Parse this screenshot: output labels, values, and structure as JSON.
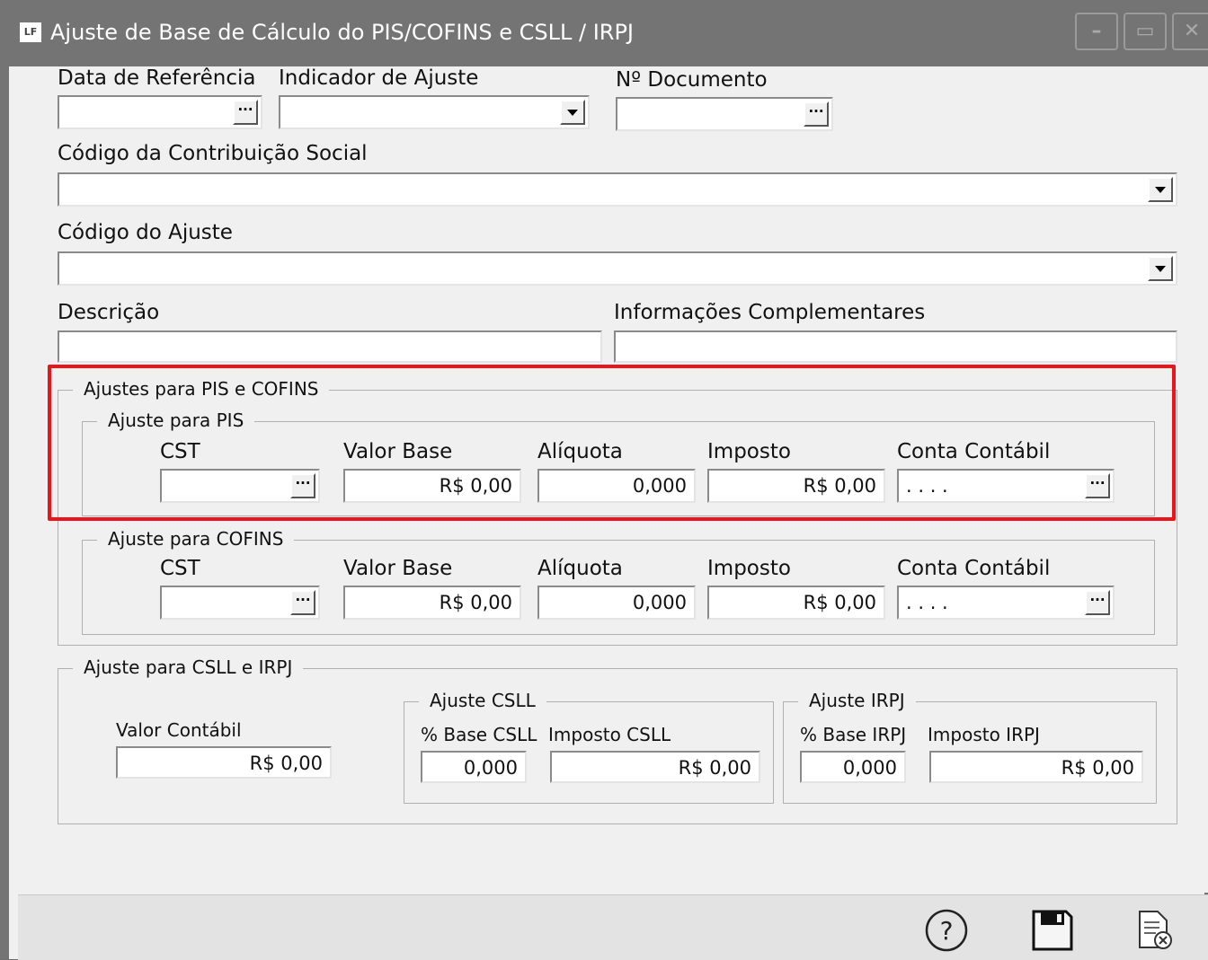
{
  "window": {
    "app_icon": "LF",
    "title": "Ajuste de Base de Cálculo do PIS/COFINS e CSLL / IRPJ"
  },
  "header": {
    "data_referencia": {
      "label": "Data de Referência",
      "value": ""
    },
    "indicador_ajuste": {
      "label": "Indicador de Ajuste",
      "value": ""
    },
    "n_documento": {
      "label": "Nº Documento",
      "value": ""
    },
    "codigo_contribuicao": {
      "label": "Código da Contribuição Social",
      "value": ""
    },
    "codigo_ajuste": {
      "label": "Código do Ajuste",
      "value": ""
    },
    "descricao": {
      "label": "Descrição",
      "value": ""
    },
    "info_complementares": {
      "label": "Informações Complementares",
      "value": ""
    }
  },
  "pis_cofins": {
    "title": "Ajustes para PIS e COFINS",
    "pis": {
      "title": "Ajuste para PIS",
      "cst_label": "CST",
      "cst_value": "",
      "valor_base_label": "Valor Base",
      "valor_base_value": "R$ 0,00",
      "aliquota_label": "Alíquota",
      "aliquota_value": "0,000",
      "imposto_label": "Imposto",
      "imposto_value": "R$ 0,00",
      "conta_label": "Conta Contábil",
      "conta_value": ". . . ."
    },
    "cofins": {
      "title": "Ajuste para COFINS",
      "cst_label": "CST",
      "cst_value": "",
      "valor_base_label": "Valor Base",
      "valor_base_value": "R$ 0,00",
      "aliquota_label": "Alíquota",
      "aliquota_value": "0,000",
      "imposto_label": "Imposto",
      "imposto_value": "R$ 0,00",
      "conta_label": "Conta Contábil",
      "conta_value": ". . . ."
    }
  },
  "csll_irpj": {
    "title": "Ajuste para CSLL e IRPJ",
    "valor_contabil_label": "Valor Contábil",
    "valor_contabil_value": "R$ 0,00",
    "csll": {
      "title": "Ajuste CSLL",
      "base_label": "% Base CSLL",
      "base_value": "0,000",
      "imposto_label": "Imposto CSLL",
      "imposto_value": "R$ 0,00"
    },
    "irpj": {
      "title": "Ajuste IRPJ",
      "base_label": "% Base IRPJ",
      "base_value": "0,000",
      "imposto_label": "Imposto IRPJ",
      "imposto_value": "R$ 0,00"
    }
  },
  "footer": {
    "help_icon": "help-icon",
    "save_icon": "save-icon",
    "cancel_icon": "cancel-document-icon"
  },
  "highlight_color": "#e8151b"
}
